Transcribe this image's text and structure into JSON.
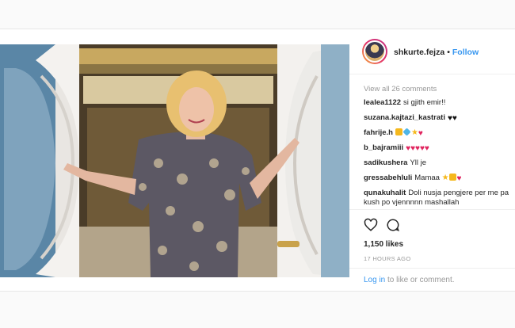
{
  "post": {
    "username": "shkurte.fejza",
    "separator": "•",
    "follow_label": "Follow",
    "photo_icon": "photo-of-woman-in-doorway",
    "view_all_label": "View all 26 comments",
    "comments": [
      {
        "user": "lealea1122",
        "text": "si gjith emir!!"
      },
      {
        "user": "suzana.kajtazi_kastrati",
        "text": "",
        "emojis": [
          "black-heart",
          "black-heart"
        ]
      },
      {
        "user": "fahrije.h",
        "text": "",
        "emojis": [
          "cat-face",
          "diamond",
          "star",
          "red-heart"
        ]
      },
      {
        "user": "b_bajramiii",
        "text": "",
        "emojis": [
          "red-heart",
          "red-heart",
          "red-heart",
          "red-heart",
          "red-heart"
        ]
      },
      {
        "user": "sadikushera",
        "text": "Yll je"
      },
      {
        "user": "gressabehluli",
        "text": "Mamaa",
        "emojis": [
          "star",
          "cat-face",
          "red-heart"
        ]
      },
      {
        "user": "qunakuhalit",
        "text": "Doli nusja pengjere per me pa kush po vjennnnn mashallah"
      }
    ],
    "likes": "1,150 likes",
    "time_ago": "17 HOURS AGO",
    "login_link": "Log in",
    "login_suffix": "to like or comment.",
    "colors": {
      "link": "#3897f0",
      "heart": "#e0245e",
      "muted": "#999999"
    }
  }
}
